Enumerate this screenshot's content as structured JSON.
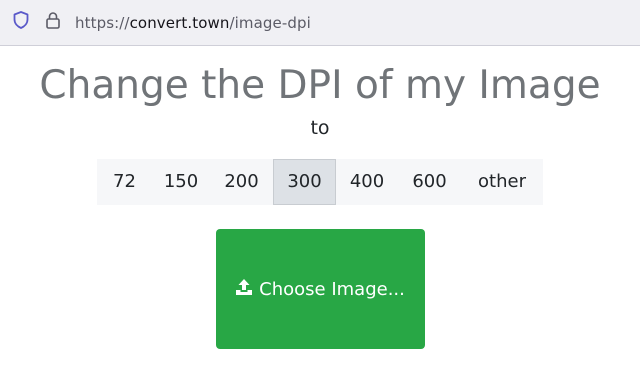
{
  "browser": {
    "url_scheme": "https://",
    "url_host": "convert.town",
    "url_path": "/image-dpi"
  },
  "page": {
    "title": "Change the DPI of my Image",
    "to_label": "to",
    "dpi_options": [
      "72",
      "150",
      "200",
      "300",
      "400",
      "600",
      "other"
    ],
    "selected_dpi": "300",
    "choose_button_label": "Choose Image..."
  },
  "colors": {
    "button_green": "#28a745",
    "selected_option": "#dde1e6",
    "title_gray": "#707478"
  },
  "icons": [
    "shield-icon",
    "lock-icon",
    "upload-icon"
  ]
}
